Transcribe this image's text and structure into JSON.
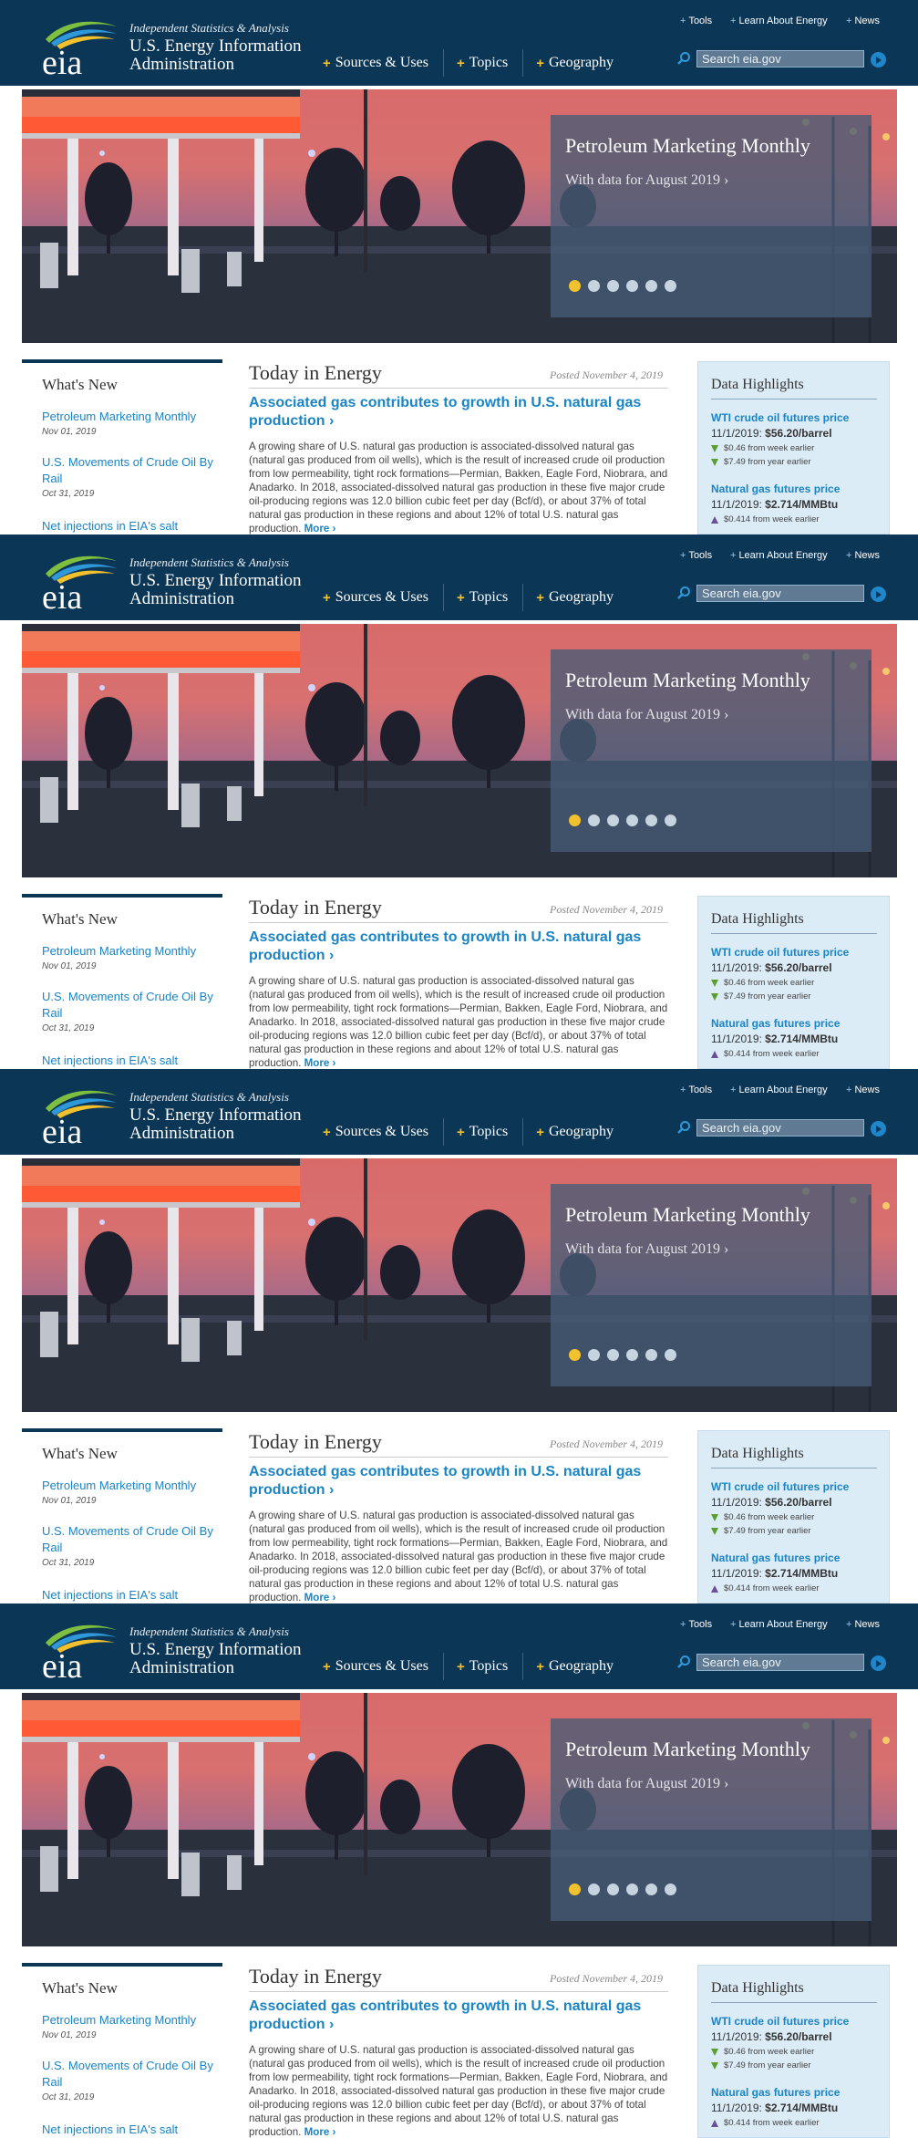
{
  "header": {
    "tagline": "Independent Statistics & Analysis",
    "org_line1": "U.S. Energy Information",
    "org_line2": "Administration",
    "logo_text": "eia",
    "nav": [
      "Sources & Uses",
      "Topics",
      "Geography"
    ],
    "util": [
      "Tools",
      "Learn About Energy",
      "News"
    ],
    "search_placeholder": "Search eia.gov",
    "icons": {
      "search": "search-icon",
      "go": "arrow-right-circle-icon",
      "plus": "plus-icon"
    }
  },
  "hero": {
    "title": "Petroleum Marketing Monthly",
    "subtitle": "With data for August 2019 ›",
    "slide_count": 6,
    "active_slide": 1
  },
  "whats_new": {
    "heading": "What's New",
    "items": [
      {
        "label": "Petroleum Marketing Monthly",
        "date": "Nov 01, 2019"
      },
      {
        "label": "U.S. Movements of Crude Oil By Rail",
        "date": "Oct 31, 2019"
      },
      {
        "label": "Net injections in EIA's salt storage region set record high",
        "date": ""
      }
    ]
  },
  "today": {
    "heading": "Today in Energy",
    "posted": "Posted November 4, 2019",
    "title": "Associated gas contributes to growth in U.S. natural gas production ›",
    "body": "A growing share of U.S. natural gas production is associated-dissolved natural gas (natural gas produced from oil wells), which is the result of increased crude oil production from low permeability, tight rock formations—Permian, Bakken, Eagle Ford, Niobrara, and Anadarko. In 2018, associated-dissolved natural gas production in these five major crude oil-producing regions was 12.0 billion cubic feet per day (Bcf/d), or about 37% of total natural gas production in these regions and about 12% of total U.S. natural gas production.",
    "more": "More ›"
  },
  "data_highlights": {
    "heading": "Data Highlights",
    "items": [
      {
        "name": "WTI crude oil futures price",
        "date": "11/1/2019:",
        "value": "$56.20/barrel",
        "changes": [
          {
            "text": "$0.46 from week earlier",
            "dir": "down"
          },
          {
            "text": "$7.49 from year earlier",
            "dir": "down"
          }
        ]
      },
      {
        "name": "Natural gas futures price",
        "date": "11/1/2019:",
        "value": "$2.714/MMBtu",
        "changes": [
          {
            "text": "$0.414 from week earlier",
            "dir": "up"
          }
        ]
      }
    ]
  },
  "colors": {
    "navy": "#0c3656",
    "link_blue": "#1a84c5",
    "accent_yellow": "#f2c12e",
    "panel_blue": "#dcecf7"
  }
}
